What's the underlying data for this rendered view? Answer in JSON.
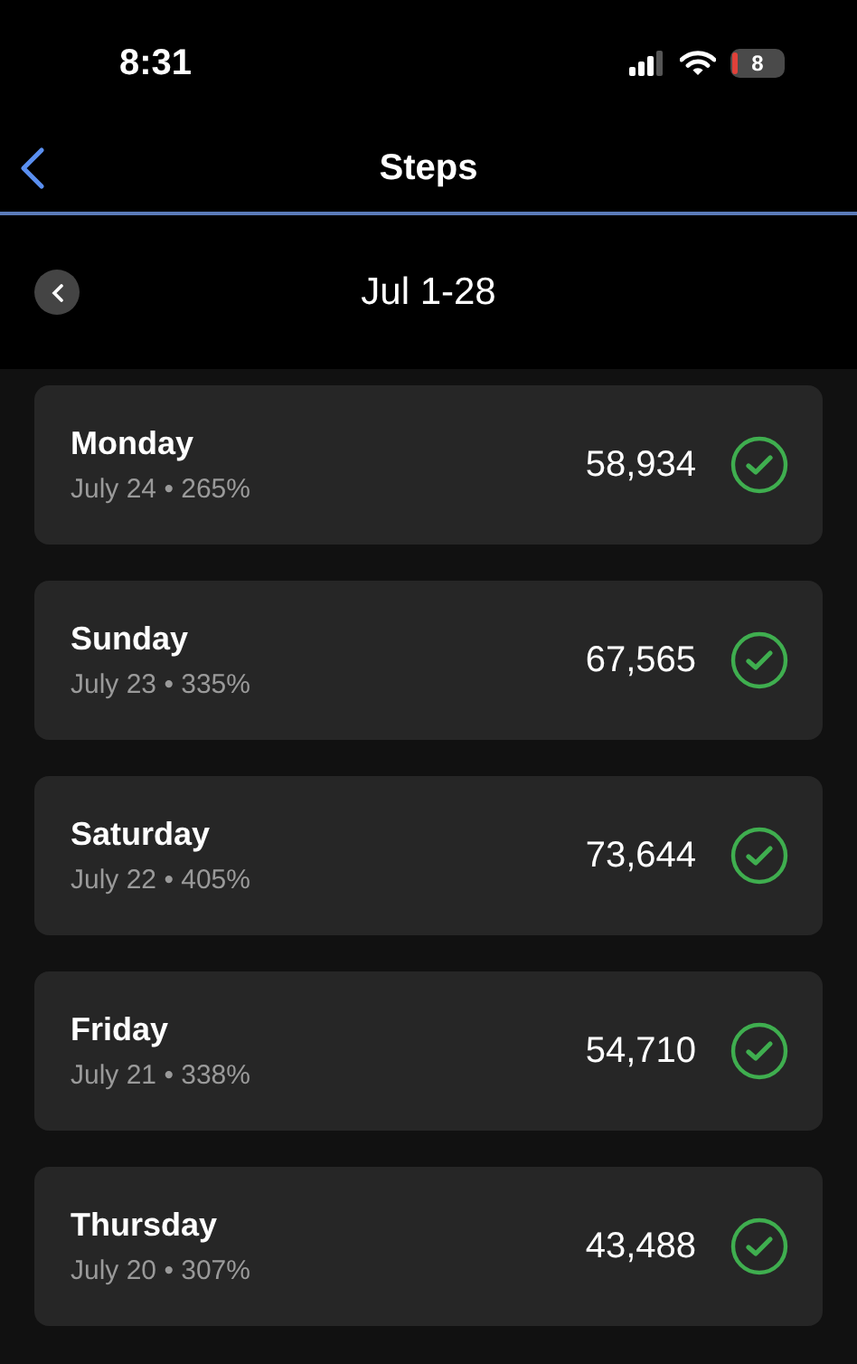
{
  "status_bar": {
    "time": "8:31",
    "battery": "8"
  },
  "nav": {
    "title": "Steps"
  },
  "period": {
    "label": "Jul 1-28"
  },
  "days": [
    {
      "day": "Monday",
      "detail": "July 24 • 265%",
      "steps": "58,934",
      "goal_met": true
    },
    {
      "day": "Sunday",
      "detail": "July 23 • 335%",
      "steps": "67,565",
      "goal_met": true
    },
    {
      "day": "Saturday",
      "detail": "July 22 • 405%",
      "steps": "73,644",
      "goal_met": true
    },
    {
      "day": "Friday",
      "detail": "July 21 • 338%",
      "steps": "54,710",
      "goal_met": true
    },
    {
      "day": "Thursday",
      "detail": "July 20 • 307%",
      "steps": "43,488",
      "goal_met": true
    }
  ]
}
